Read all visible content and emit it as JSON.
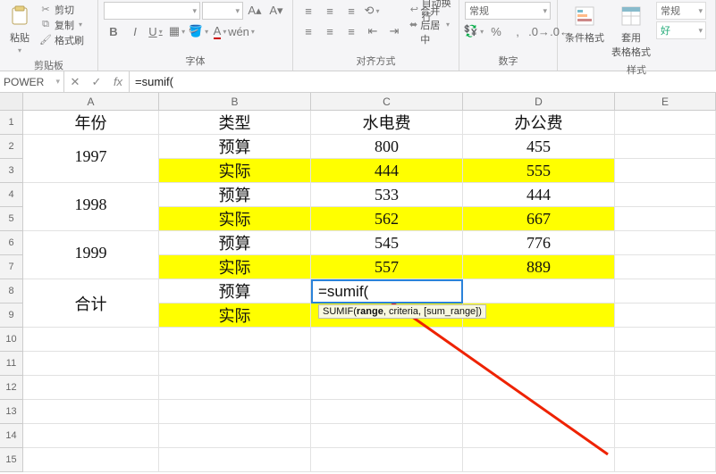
{
  "ribbon": {
    "clipboard": {
      "paste": "粘贴",
      "cut": "剪切",
      "copy": "复制",
      "format_painter": "格式刷",
      "group": "剪贴板"
    },
    "font": {
      "group": "字体"
    },
    "align": {
      "wrap": "自动换行",
      "merge": "合并后居中",
      "group": "对齐方式"
    },
    "number": {
      "general": "常规",
      "group": "数字"
    },
    "styles": {
      "cond": "条件格式",
      "table": "套用\n表格格式",
      "normal": "常规",
      "good": "好",
      "group": "样式"
    }
  },
  "formula_bar": {
    "name_box": "POWER",
    "fx_label": "fx",
    "input": "=sumif("
  },
  "columns": {
    "A": "A",
    "B": "B",
    "C": "C",
    "D": "D",
    "E": "E"
  },
  "rownums": [
    "1",
    "2",
    "3",
    "4",
    "5",
    "6",
    "7",
    "8",
    "9",
    "10",
    "11",
    "12",
    "13",
    "14",
    "15"
  ],
  "cells": {
    "header": {
      "A": "年份",
      "B": "类型",
      "C": "水电费",
      "D": "办公费"
    },
    "r2": {
      "B": "预算",
      "C": "800",
      "D": "455"
    },
    "r3": {
      "B": "实际",
      "C": "444",
      "D": "555"
    },
    "y1997": "1997",
    "r4": {
      "B": "预算",
      "C": "533",
      "D": "444"
    },
    "r5": {
      "B": "实际",
      "C": "562",
      "D": "667"
    },
    "y1998": "1998",
    "r6": {
      "B": "预算",
      "C": "545",
      "D": "776"
    },
    "r7": {
      "B": "实际",
      "C": "557",
      "D": "889"
    },
    "y1999": "1999",
    "r8": {
      "B": "预算",
      "C": "=sumif("
    },
    "r9": {
      "B": "实际"
    },
    "total": "合计"
  },
  "tooltip": {
    "fn": "SUMIF(",
    "arg1": "range",
    "rest": ", criteria, [sum_range])"
  },
  "chart_data": {
    "type": "table",
    "columns": [
      "年份",
      "类型",
      "水电费",
      "办公费"
    ],
    "rows": [
      [
        "1997",
        "预算",
        800,
        455
      ],
      [
        "1997",
        "实际",
        444,
        555
      ],
      [
        "1998",
        "预算",
        533,
        444
      ],
      [
        "1998",
        "实际",
        562,
        667
      ],
      [
        "1999",
        "预算",
        545,
        776
      ],
      [
        "1999",
        "实际",
        557,
        889
      ],
      [
        "合计",
        "预算",
        null,
        null
      ],
      [
        "合计",
        "实际",
        null,
        null
      ]
    ]
  }
}
